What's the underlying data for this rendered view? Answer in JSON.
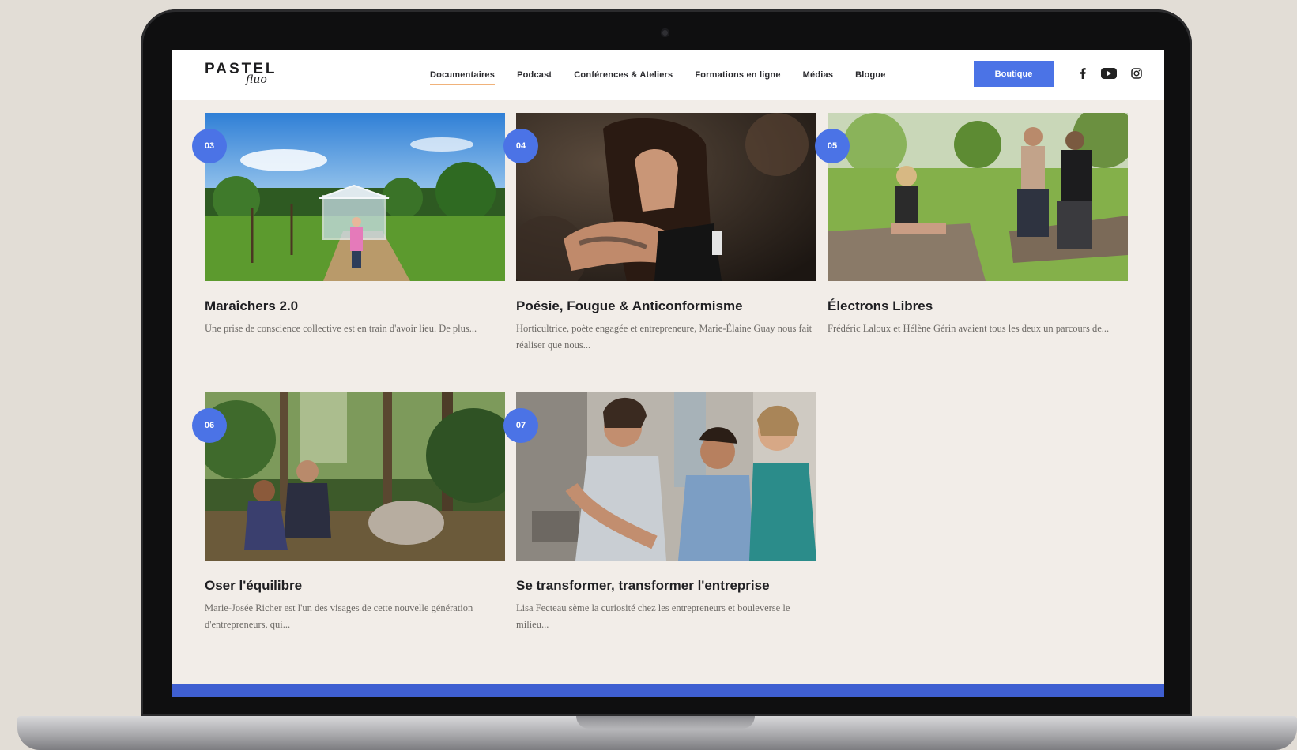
{
  "site": {
    "logo_text": "PASTEL",
    "logo_script": "fluo"
  },
  "nav": {
    "items": [
      {
        "label": "Documentaires",
        "active": true
      },
      {
        "label": "Podcast",
        "active": false
      },
      {
        "label": "Conférences & Ateliers",
        "active": false
      },
      {
        "label": "Formations en ligne",
        "active": false
      },
      {
        "label": "Médias",
        "active": false
      },
      {
        "label": "Blogue",
        "active": false
      }
    ],
    "shop_label": "Boutique",
    "social_icons": [
      "facebook-icon",
      "youtube-icon",
      "instagram-icon"
    ]
  },
  "cards": [
    {
      "number": "03",
      "title": "Maraîchers 2.0",
      "description": "Une prise de conscience collective est en train d'avoir lieu. De plus..."
    },
    {
      "number": "04",
      "title": "Poésie, Fougue & Anticonformisme",
      "description": "Horticultrice, poète engagée et entrepreneure, Marie-Élaine Guay nous fait réaliser que nous..."
    },
    {
      "number": "05",
      "title": "Électrons Libres",
      "description": "Frédéric Laloux et Hélène Gérin avaient tous les deux un parcours de..."
    },
    {
      "number": "06",
      "title": "Oser l'équilibre",
      "description": "Marie-Josée Richer est l'un des visages de cette nouvelle génération d'entrepreneurs, qui..."
    },
    {
      "number": "07",
      "title": "Se transformer, transformer l'entreprise",
      "description": "Lisa Fecteau sème la curiosité chez les entrepreneurs et bouleverse le milieu..."
    }
  ],
  "colors": {
    "accent_blue": "#4b73e6",
    "nav_underline": "#f0b27a",
    "page_bg": "#f2ede8",
    "footer_bar": "#3f5fd1"
  }
}
